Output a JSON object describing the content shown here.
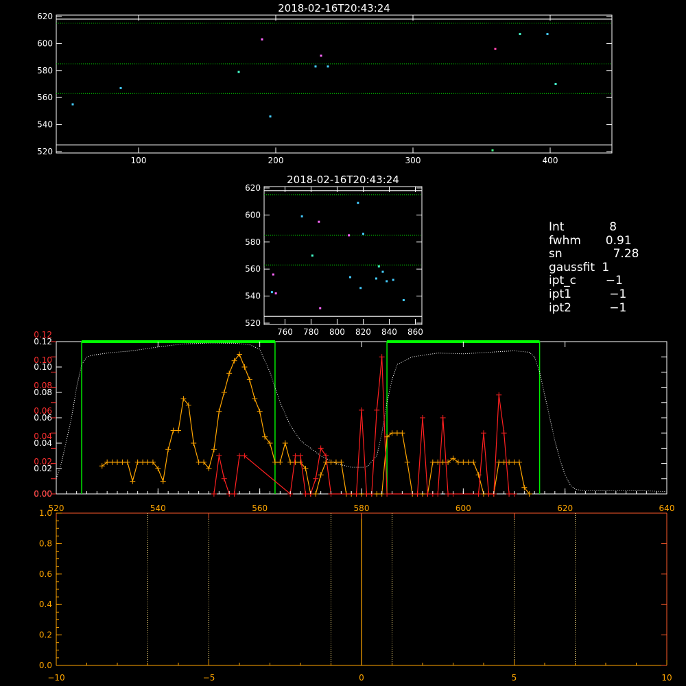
{
  "chart_data": [
    {
      "type": "scatter",
      "title": "2018-02-16T20:43:24",
      "xlim": [
        40,
        445
      ],
      "ylim": [
        519,
        621
      ],
      "x_ticks": [
        100,
        200,
        300,
        400
      ],
      "y_ticks": [
        520,
        540,
        560,
        580,
        600,
        620
      ],
      "hlines_solid": [
        525,
        618
      ],
      "hlines_dotted": [
        563,
        585,
        615
      ],
      "points": [
        {
          "x": 52,
          "y": 555,
          "color": "#44ccff"
        },
        {
          "x": 87,
          "y": 567,
          "color": "#44ccff"
        },
        {
          "x": 173,
          "y": 579,
          "color": "#44ffcc"
        },
        {
          "x": 190,
          "y": 603,
          "color": "#ff66ff"
        },
        {
          "x": 196,
          "y": 546,
          "color": "#44ccff"
        },
        {
          "x": 229,
          "y": 583,
          "color": "#44ccff"
        },
        {
          "x": 233,
          "y": 591,
          "color": "#ff66ff"
        },
        {
          "x": 238,
          "y": 583,
          "color": "#44ccff"
        },
        {
          "x": 358,
          "y": 521,
          "color": "#44ff88"
        },
        {
          "x": 360,
          "y": 596,
          "color": "#ff44aa"
        },
        {
          "x": 378,
          "y": 607,
          "color": "#44ffcc"
        },
        {
          "x": 398,
          "y": 607,
          "color": "#44ccff"
        },
        {
          "x": 404,
          "y": 570,
          "color": "#44ffcc"
        }
      ]
    },
    {
      "type": "scatter",
      "title": "2018-02-16T20:43:24",
      "xlim": [
        744,
        865
      ],
      "ylim": [
        519,
        621
      ],
      "x_ticks": [
        760,
        780,
        800,
        820,
        840,
        860
      ],
      "y_ticks": [
        520,
        540,
        560,
        580,
        600,
        620
      ],
      "hlines_solid": [
        525,
        618
      ],
      "hlines_dotted": [
        563,
        585,
        615
      ],
      "points": [
        {
          "x": 750,
          "y": 543,
          "color": "#44ccff"
        },
        {
          "x": 751,
          "y": 556,
          "color": "#ff66ff"
        },
        {
          "x": 753,
          "y": 542,
          "color": "#ff66ff"
        },
        {
          "x": 773,
          "y": 599,
          "color": "#44ccff"
        },
        {
          "x": 781,
          "y": 570,
          "color": "#44ffcc"
        },
        {
          "x": 786,
          "y": 595,
          "color": "#ff66ff"
        },
        {
          "x": 787,
          "y": 531,
          "color": "#ff66ff"
        },
        {
          "x": 809,
          "y": 585,
          "color": "#ff66ff"
        },
        {
          "x": 810,
          "y": 554,
          "color": "#44ccff"
        },
        {
          "x": 816,
          "y": 609,
          "color": "#44ccff"
        },
        {
          "x": 818,
          "y": 546,
          "color": "#44ccff"
        },
        {
          "x": 820,
          "y": 586,
          "color": "#44ccff"
        },
        {
          "x": 830,
          "y": 553,
          "color": "#44ccff"
        },
        {
          "x": 832,
          "y": 562,
          "color": "#44ffcc"
        },
        {
          "x": 835,
          "y": 558,
          "color": "#44ccff"
        },
        {
          "x": 838,
          "y": 551,
          "color": "#44ccff"
        },
        {
          "x": 843,
          "y": 552,
          "color": "#44ccff"
        },
        {
          "x": 851,
          "y": 537,
          "color": "#44ccff"
        }
      ]
    },
    {
      "type": "line",
      "xlim": [
        520,
        640
      ],
      "x_ticks": [
        520,
        540,
        560,
        580,
        600,
        620,
        640
      ],
      "y_ticks_left": [
        "0.00",
        "0.02",
        "0.04",
        "0.06",
        "0.08",
        "0.10",
        "0.12"
      ],
      "y_ticks_overlay": [
        "0.00",
        "0.02",
        "0.04",
        "0.06",
        "0.08",
        "0.10",
        "0.12"
      ],
      "ylim_left": [
        0,
        0.12
      ],
      "ylim_right": [
        0,
        0.2
      ],
      "green_boxes": [
        [
          525,
          563
        ],
        [
          585,
          615
        ]
      ],
      "box_level": 0.2,
      "series": [
        {
          "color": "#ffffff",
          "style": "dotted",
          "axis": "right",
          "x": [
            520,
            521,
            522,
            523,
            524,
            525,
            526,
            527,
            528,
            530,
            535,
            540,
            545,
            550,
            555,
            558,
            560,
            562,
            564,
            566,
            568,
            570,
            572,
            575,
            578,
            581,
            583,
            584,
            585,
            586,
            587,
            590,
            595,
            600,
            605,
            610,
            613,
            614,
            615,
            616,
            617,
            618,
            619,
            620,
            621,
            622,
            624,
            628,
            632,
            636,
            640
          ],
          "y": [
            0.02,
            0.04,
            0.07,
            0.1,
            0.14,
            0.17,
            0.18,
            0.182,
            0.183,
            0.185,
            0.188,
            0.193,
            0.197,
            0.198,
            0.198,
            0.196,
            0.19,
            0.16,
            0.12,
            0.09,
            0.07,
            0.06,
            0.05,
            0.04,
            0.035,
            0.035,
            0.05,
            0.08,
            0.12,
            0.15,
            0.17,
            0.18,
            0.185,
            0.184,
            0.186,
            0.188,
            0.186,
            0.18,
            0.16,
            0.13,
            0.1,
            0.07,
            0.045,
            0.025,
            0.012,
            0.006,
            0.004,
            0.004,
            0.004,
            0.004,
            0.003
          ]
        },
        {
          "color": "#ffa500",
          "style": "crosses",
          "axis": "left",
          "x": [
            529,
            530,
            531,
            532,
            533,
            534,
            535,
            536,
            537,
            538,
            539,
            540,
            541,
            542,
            543,
            544,
            545,
            546,
            547,
            548,
            549,
            550,
            551,
            552,
            553,
            554,
            555,
            556,
            557,
            558,
            559,
            560,
            561,
            562,
            563,
            564,
            565,
            566,
            567,
            568,
            569,
            570,
            571,
            572,
            573,
            574,
            575,
            576,
            577,
            578,
            579,
            580,
            581,
            582,
            583,
            584,
            585,
            586,
            587,
            588,
            589,
            590,
            591,
            592,
            593,
            594,
            595,
            596,
            597,
            598,
            599,
            600,
            601,
            602,
            603,
            604,
            605,
            606,
            607,
            608,
            609,
            610,
            611,
            612,
            613
          ],
          "y": [
            0.022,
            0.025,
            0.025,
            0.025,
            0.025,
            0.025,
            0.01,
            0.025,
            0.025,
            0.025,
            0.025,
            0.02,
            0.01,
            0.035,
            0.05,
            0.05,
            0.075,
            0.07,
            0.04,
            0.025,
            0.025,
            0.02,
            0.035,
            0.065,
            0.08,
            0.095,
            0.105,
            0.11,
            0.1,
            0.09,
            0.075,
            0.065,
            0.045,
            0.04,
            0.025,
            0.025,
            0.04,
            0.025,
            0.025,
            0.025,
            0.02,
            0.0,
            0.0,
            0.015,
            0.025,
            0.025,
            0.025,
            0.025,
            0.0,
            0.0,
            0.0,
            0.0,
            0.0,
            0.0,
            0.0,
            0.0,
            0.045,
            0.048,
            0.048,
            0.048,
            0.025,
            0.0,
            0.0,
            0.0,
            0.0,
            0.025,
            0.025,
            0.025,
            0.025,
            0.028,
            0.025,
            0.025,
            0.025,
            0.025,
            0.015,
            0.0,
            0.0,
            0.0,
            0.025,
            0.025,
            0.025,
            0.025,
            0.025,
            0.005,
            0.0
          ]
        },
        {
          "color": "#ff2020",
          "style": "crosses",
          "axis": "right",
          "x": [
            551,
            552,
            553,
            554,
            555,
            556,
            557,
            566,
            567,
            568,
            569,
            570,
            571,
            572,
            573,
            574,
            579,
            580,
            581,
            582,
            583,
            584,
            585,
            591,
            592,
            593,
            594,
            595,
            596,
            597,
            598,
            603,
            604,
            605,
            606,
            607,
            608,
            609,
            610
          ],
          "y": [
            0.0,
            0.05,
            0.02,
            0.0,
            0.0,
            0.05,
            0.05,
            0.0,
            0.05,
            0.05,
            0.0,
            0.0,
            0.02,
            0.06,
            0.05,
            0.0,
            0.0,
            0.11,
            0.0,
            0.0,
            0.11,
            0.18,
            0.0,
            0.0,
            0.1,
            0.0,
            0.0,
            0.0,
            0.1,
            0.0,
            0.0,
            0.0,
            0.08,
            0.0,
            0.0,
            0.13,
            0.08,
            0.0,
            0.0
          ]
        }
      ]
    },
    {
      "type": "line",
      "xlim": [
        -10,
        10
      ],
      "ylim": [
        0,
        1.0
      ],
      "x_ticks": [
        -10,
        -5,
        0,
        5,
        10
      ],
      "x_tick_labels": [
        "−10",
        "−5",
        "0",
        "5",
        "10"
      ],
      "y_ticks": [
        "0.0",
        "0.2",
        "0.4",
        "0.6",
        "0.8",
        "1.0"
      ],
      "vlines_dotted": [
        -7,
        -5,
        -1,
        1,
        5,
        7
      ],
      "vline_solid": 0
    }
  ],
  "info_panel": [
    {
      "key": "Int",
      "value": "   8"
    },
    {
      "key": "fwhm",
      "value": "  0.91"
    },
    {
      "key": "sn",
      "value": "    7.28"
    },
    {
      "key": "gaussfit",
      "value": " 1"
    },
    {
      "key": "ipt_c",
      "value": "  −1"
    },
    {
      "key": "ipt1",
      "value": "   −1"
    },
    {
      "key": "ipt2",
      "value": "   −1"
    }
  ],
  "colors": {
    "axis": "#ffffff",
    "green": "#00ff00",
    "orange": "#ffa500",
    "red": "#ff2020"
  }
}
